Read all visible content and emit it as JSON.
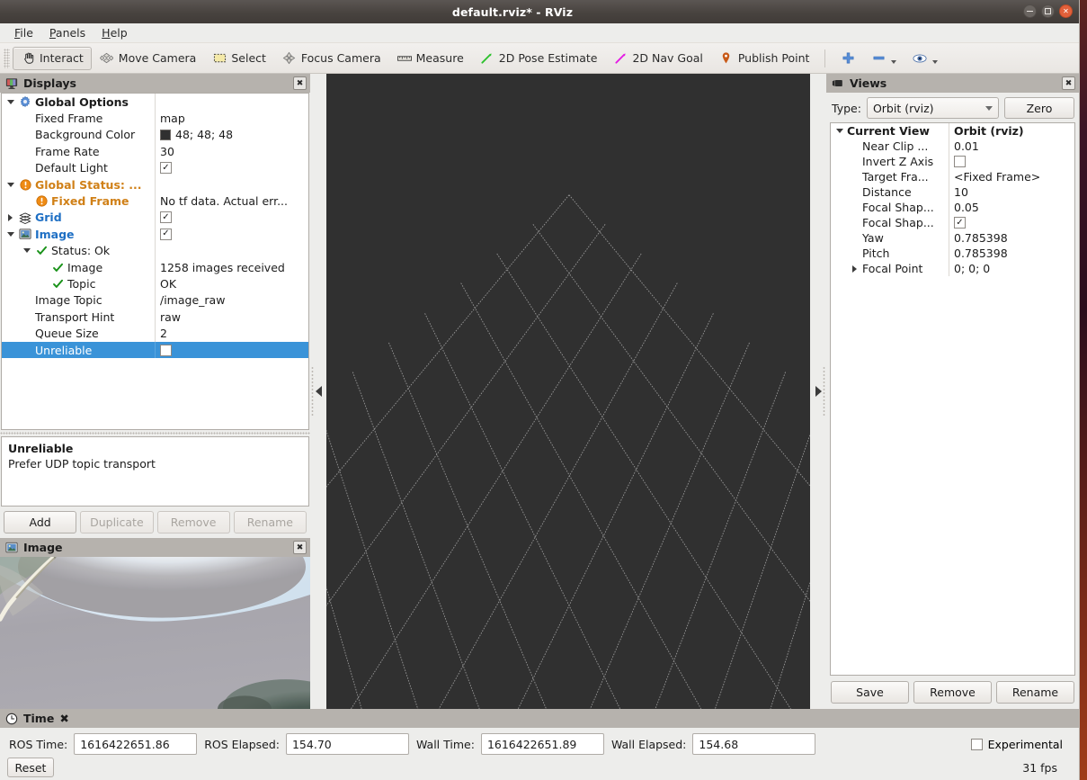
{
  "window": {
    "title": "default.rviz* - RViz",
    "minimize_label": "–",
    "maximize_label": "□",
    "close_label": "✕"
  },
  "menubar": {
    "items": [
      {
        "label": "File",
        "mnemonic": "F",
        "rest": "ile"
      },
      {
        "label": "Panels",
        "mnemonic": "P",
        "rest": "anels"
      },
      {
        "label": "Help",
        "mnemonic": "H",
        "rest": "elp"
      }
    ]
  },
  "toolbar": {
    "buttons": [
      {
        "label": "Interact",
        "icon": "hand-cursor-icon",
        "active": true
      },
      {
        "label": "Move Camera",
        "icon": "move-camera-icon",
        "active": false
      },
      {
        "label": "Select",
        "icon": "selection-rect-icon",
        "active": false
      },
      {
        "label": "Focus Camera",
        "icon": "focus-camera-icon",
        "active": false
      },
      {
        "label": "Measure",
        "icon": "ruler-icon",
        "active": false
      },
      {
        "label": "2D Pose Estimate",
        "icon": "green-arrow-icon",
        "active": false
      },
      {
        "label": "2D Nav Goal",
        "icon": "magenta-arrow-icon",
        "active": false
      },
      {
        "label": "Publish Point",
        "icon": "map-pin-icon",
        "active": false
      }
    ],
    "extra_icons": [
      {
        "name": "plus-icon",
        "glyph": "+"
      },
      {
        "name": "minus-icon",
        "glyph": "−"
      },
      {
        "name": "eye-icon",
        "glyph": "◉"
      }
    ]
  },
  "displays_panel": {
    "title": "Displays",
    "icon": "displays-monitor-icon",
    "close_label": "✖",
    "rows": [
      {
        "indent": 0,
        "expander": "down",
        "icon": "gear-icon",
        "label": "Global Options",
        "style": "bold",
        "value": "",
        "value_type": "none"
      },
      {
        "indent": 1,
        "expander": "none",
        "icon": "none",
        "label": "Fixed Frame",
        "style": "normal",
        "value": "map",
        "value_type": "text"
      },
      {
        "indent": 1,
        "expander": "none",
        "icon": "none",
        "label": "Background Color",
        "style": "normal",
        "value": "48; 48; 48",
        "value_type": "color",
        "color": "#303030"
      },
      {
        "indent": 1,
        "expander": "none",
        "icon": "none",
        "label": "Frame Rate",
        "style": "normal",
        "value": "30",
        "value_type": "text"
      },
      {
        "indent": 1,
        "expander": "none",
        "icon": "none",
        "label": "Default Light",
        "style": "normal",
        "value": "✓",
        "value_type": "checkbox_checked"
      },
      {
        "indent": 0,
        "expander": "down",
        "icon": "warning-icon",
        "label": "Global Status: ...",
        "style": "orange",
        "value": "",
        "value_type": "none"
      },
      {
        "indent": 1,
        "expander": "none",
        "icon": "warning-icon",
        "label": "Fixed Frame",
        "style": "orange",
        "value": "No tf data.  Actual err...",
        "value_type": "text"
      },
      {
        "indent": 0,
        "expander": "right",
        "icon": "grid-icon",
        "label": "Grid",
        "style": "blue",
        "value": "✓",
        "value_type": "checkbox_checked"
      },
      {
        "indent": 0,
        "expander": "down",
        "icon": "image-icon",
        "label": "Image",
        "style": "blue",
        "value": "✓",
        "value_type": "checkbox_checked"
      },
      {
        "indent": 1,
        "expander": "down",
        "icon": "check-icon",
        "label": "Status: Ok",
        "style": "normal",
        "value": "",
        "value_type": "none"
      },
      {
        "indent": 2,
        "expander": "none",
        "icon": "check-icon",
        "label": "Image",
        "style": "normal",
        "value": "1258 images received",
        "value_type": "text"
      },
      {
        "indent": 2,
        "expander": "none",
        "icon": "check-icon",
        "label": "Topic",
        "style": "normal",
        "value": "OK",
        "value_type": "text"
      },
      {
        "indent": 1,
        "expander": "none",
        "icon": "none",
        "label": "Image Topic",
        "style": "normal",
        "value": "/image_raw",
        "value_type": "text"
      },
      {
        "indent": 1,
        "expander": "none",
        "icon": "none",
        "label": "Transport Hint",
        "style": "normal",
        "value": "raw",
        "value_type": "text"
      },
      {
        "indent": 1,
        "expander": "none",
        "icon": "none",
        "label": "Queue Size",
        "style": "normal",
        "value": "2",
        "value_type": "text"
      },
      {
        "indent": 1,
        "expander": "none",
        "icon": "none",
        "label": "Unreliable",
        "style": "normal",
        "value": "",
        "value_type": "checkbox_unchecked",
        "selected": true
      }
    ],
    "description": {
      "title": "Unreliable",
      "text": "Prefer UDP topic transport"
    },
    "buttons": [
      {
        "label": "Add",
        "enabled": true
      },
      {
        "label": "Duplicate",
        "enabled": false
      },
      {
        "label": "Remove",
        "enabled": false
      },
      {
        "label": "Rename",
        "enabled": false
      }
    ]
  },
  "image_panel": {
    "title": "Image",
    "icon": "image-icon",
    "close_label": "✖"
  },
  "views_panel": {
    "title": "Views",
    "icon": "camera-view-icon",
    "close_label": "✖",
    "type_label": "Type:",
    "type_value": "Orbit (rviz)",
    "zero_label": "Zero",
    "rows": [
      {
        "indent": 0,
        "expander": "down",
        "label": "Current View",
        "style": "bold",
        "value": "Orbit (rviz)",
        "value_type": "text",
        "value_style": "bold"
      },
      {
        "indent": 1,
        "expander": "none",
        "label": "Near Clip ...",
        "style": "normal",
        "value": "0.01",
        "value_type": "text"
      },
      {
        "indent": 1,
        "expander": "none",
        "label": "Invert Z Axis",
        "style": "normal",
        "value": "",
        "value_type": "checkbox_unchecked"
      },
      {
        "indent": 1,
        "expander": "none",
        "label": "Target Fra...",
        "style": "normal",
        "value": "<Fixed Frame>",
        "value_type": "text"
      },
      {
        "indent": 1,
        "expander": "none",
        "label": "Distance",
        "style": "normal",
        "value": "10",
        "value_type": "text"
      },
      {
        "indent": 1,
        "expander": "none",
        "label": "Focal Shap...",
        "style": "normal",
        "value": "0.05",
        "value_type": "text"
      },
      {
        "indent": 1,
        "expander": "none",
        "label": "Focal Shap...",
        "style": "normal",
        "value": "✓",
        "value_type": "checkbox_checked"
      },
      {
        "indent": 1,
        "expander": "none",
        "label": "Yaw",
        "style": "normal",
        "value": "0.785398",
        "value_type": "text"
      },
      {
        "indent": 1,
        "expander": "none",
        "label": "Pitch",
        "style": "normal",
        "value": "0.785398",
        "value_type": "text"
      },
      {
        "indent": 1,
        "expander": "right",
        "label": "Focal Point",
        "style": "normal",
        "value": "0; 0; 0",
        "value_type": "text"
      }
    ],
    "buttons": [
      {
        "label": "Save"
      },
      {
        "label": "Remove"
      },
      {
        "label": "Rename"
      }
    ]
  },
  "time_panel": {
    "title": "Time",
    "icon": "clock-icon",
    "close_label": "✖",
    "fields": [
      {
        "label": "ROS Time:",
        "value": "1616422651.86"
      },
      {
        "label": "ROS Elapsed:",
        "value": "154.70"
      },
      {
        "label": "Wall Time:",
        "value": "1616422651.89"
      },
      {
        "label": "Wall Elapsed:",
        "value": "154.68"
      }
    ],
    "experimental_label": "Experimental",
    "experimental_checked": false,
    "reset_label": "Reset",
    "fps": "31 fps"
  },
  "viewport": {
    "background_color": "#303030",
    "grid_line_color": "#a8a8a8"
  }
}
